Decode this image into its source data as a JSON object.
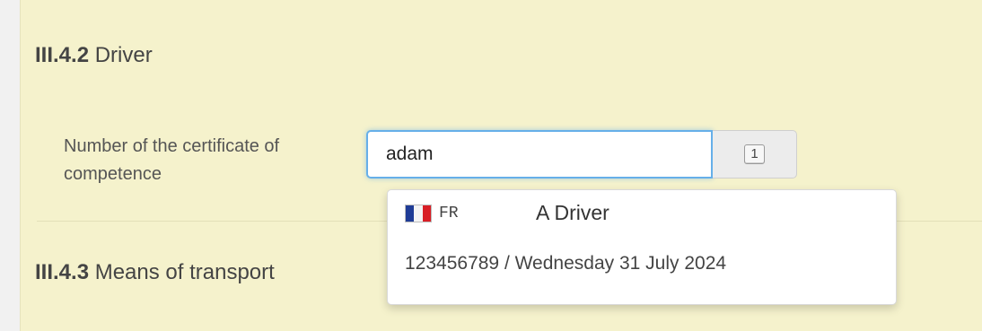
{
  "sections": [
    {
      "number": "III.4.2",
      "title": "Driver"
    },
    {
      "number": "III.4.3",
      "title": "Means of transport"
    }
  ],
  "field": {
    "label": "Number of the certificate of competence",
    "value": "adam",
    "count_badge": "1"
  },
  "suggestion": {
    "flag_icon": "france-flag-icon",
    "country_code": "FR",
    "name": "A Driver",
    "details": "123456789 / Wednesday 31 July 2024"
  },
  "colors": {
    "panel_background": "#f5f2cc",
    "focus_border": "#66afe9"
  }
}
